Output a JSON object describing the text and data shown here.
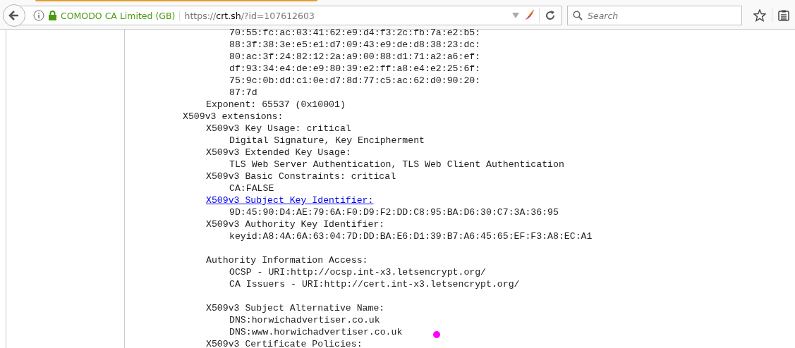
{
  "toolbar": {
    "identity": "COMODO CA Limited (GB)",
    "url": {
      "scheme": "https://",
      "host": "crt.sh",
      "path": "/?id=107612603"
    },
    "search": {
      "placeholder": "Search"
    }
  },
  "certificate_text": [
    {
      "children": [
        {
          "children": [
            {
              "children": [
                {
                  "text": "70:55:fc:ac:03:41:62:e9:d4:f3:2c:fb:7a:e2:b5:"
                },
                {
                  "text": "88:3f:38:3e:e5:e1:d7:09:43:e9:de:d8:38:23:dc:"
                },
                {
                  "text": "80:ac:3f:24:82:12:2a:a9:00:88:d1:71:a2:a6:ef:"
                },
                {
                  "text": "df:93:34:e4:de:e9:80:39:e2:ff:a8:e4:e2:25:6f:"
                },
                {
                  "text": "75:9c:0b:dd:c1:0e:d7:8d:77:c5:ac:62:d0:90:20:"
                },
                {
                  "text": "87:7d"
                }
              ]
            },
            {
              "text": "Exponent: 65537 (0x10001)"
            }
          ]
        }
      ]
    },
    {
      "text": "X509v3 extensions:",
      "children": [
        {
          "text": "X509v3 Key Usage: critical",
          "children": [
            {
              "text": "Digital Signature, Key Encipherment"
            }
          ]
        },
        {
          "text": "X509v3 Extended Key Usage:",
          "children": [
            {
              "text": "TLS Web Server Authentication, TLS Web Client Authentication"
            }
          ]
        },
        {
          "text": "X509v3 Basic Constraints: critical",
          "children": [
            {
              "text": "CA:FALSE"
            }
          ]
        },
        {
          "text": "X509v3 Subject Key Identifier:",
          "kind": "link",
          "children": [
            {
              "text": "9D:45:90:D4:AE:79:6A:F0:D9:F2:DD:C8:95:BA:D6:30:C7:3A:36:95"
            }
          ]
        },
        {
          "text": "X509v3 Authority Key Identifier:",
          "children": [
            {
              "text": "keyid:A8:4A:6A:63:04:7D:DD:BA:E6:D1:39:B7:A6:45:65:EF:F3:A8:EC:A1"
            }
          ]
        },
        {
          "text": "Authority Information Access:",
          "spaced_before": true,
          "children": [
            {
              "text": "OCSP - URI:http://ocsp.int-x3.letsencrypt.org/"
            },
            {
              "text": "CA Issuers - URI:http://cert.int-x3.letsencrypt.org/"
            }
          ]
        },
        {
          "text": "X509v3 Subject Alternative Name:",
          "spaced_before": true,
          "children": [
            {
              "text": "DNS:horwichadvertiser.co.uk"
            },
            {
              "text": "DNS:www.horwichadvertiser.co.uk"
            }
          ]
        },
        {
          "text": "X509v3 Certificate Policies:"
        }
      ]
    }
  ]
}
